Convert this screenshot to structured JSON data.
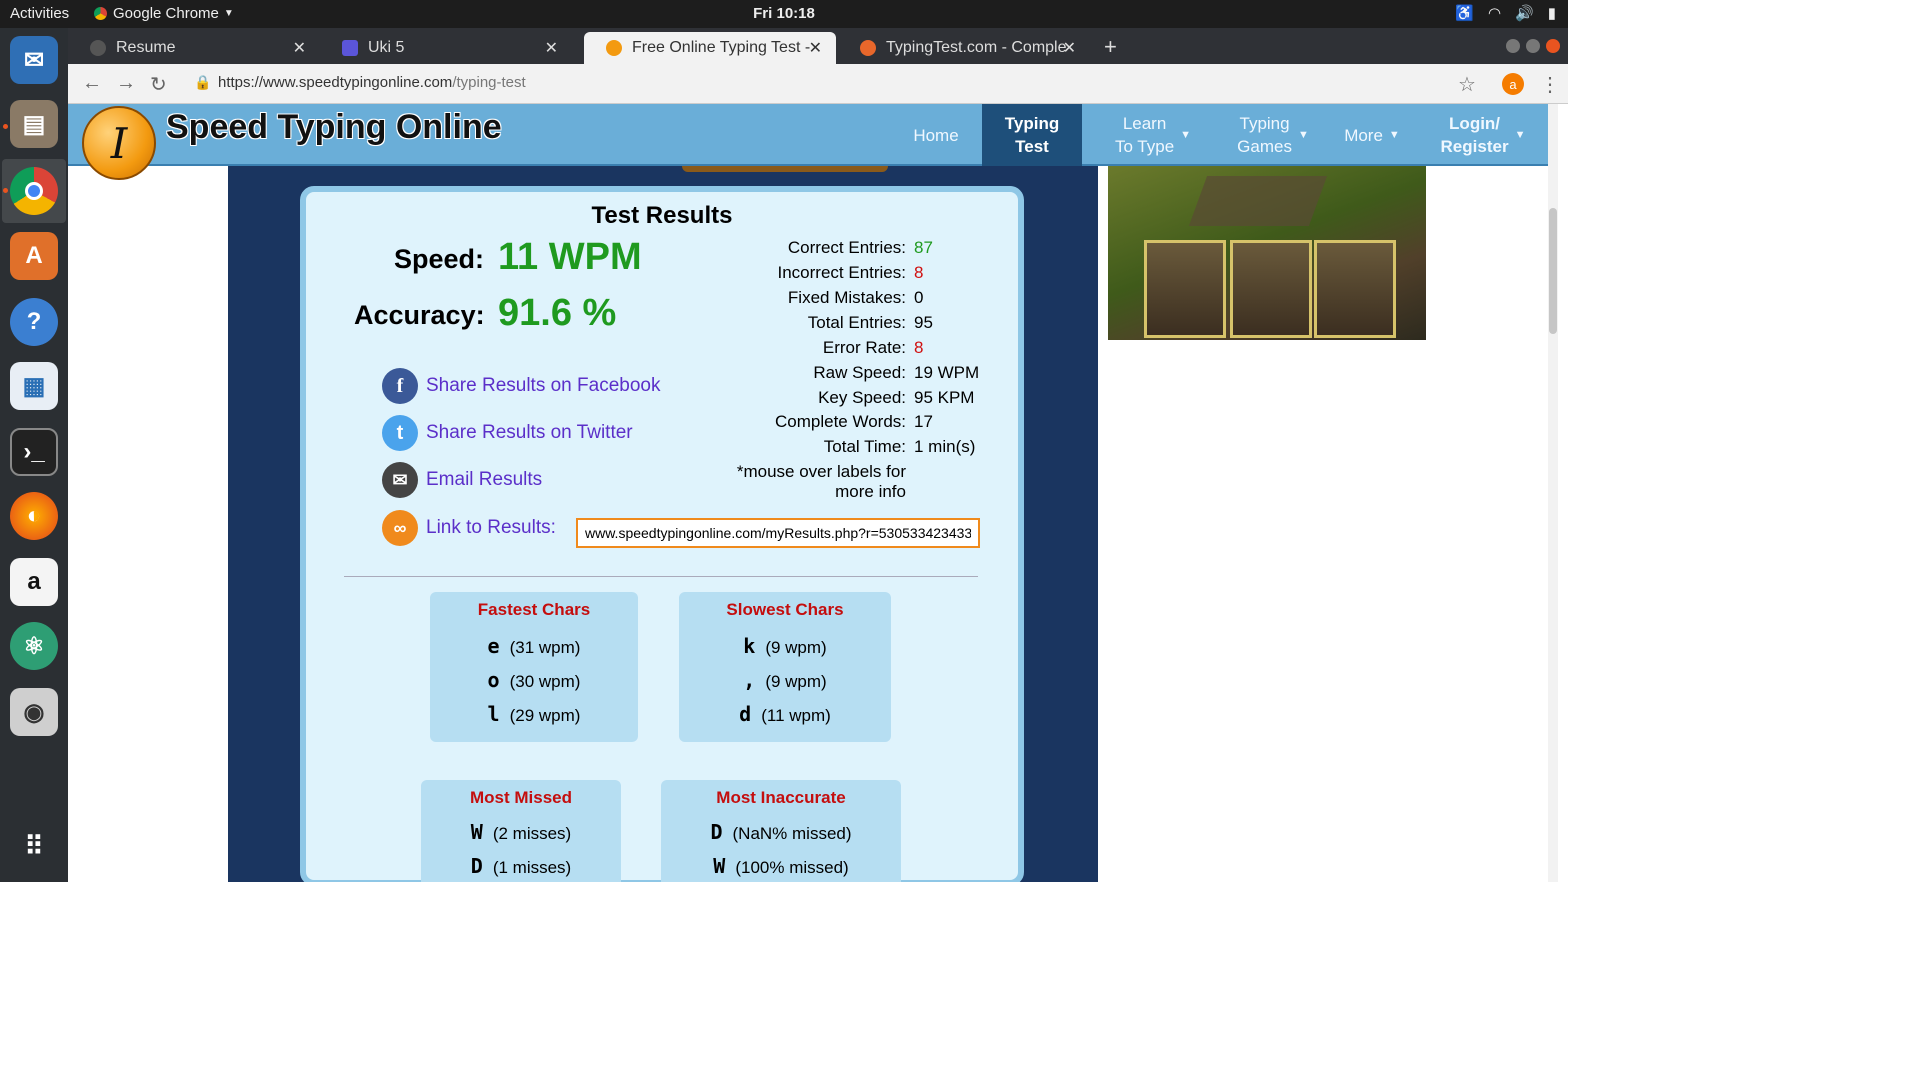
{
  "system": {
    "activities": "Activities",
    "app_name": "Google Chrome",
    "clock": "Fri 10:18"
  },
  "tabs": [
    {
      "title": "Resume",
      "favicon_color": "#555555"
    },
    {
      "title": "Uki 5",
      "favicon_color": "#5b55d9"
    },
    {
      "title": "Free Online Typing Test - S",
      "favicon_color": "#f39a10"
    },
    {
      "title": "TypingTest.com - Complete",
      "favicon_color": "#e8672b"
    }
  ],
  "url": {
    "scheme": "https://",
    "host": "www.speedtypingonline.com",
    "path": "/typing-test"
  },
  "profile_initial": "a",
  "site": {
    "brand": "Speed Typing Online",
    "logo_letter": "I",
    "nav": [
      {
        "label": "Home"
      },
      {
        "label": "Typing\nTest"
      },
      {
        "label": "Learn\nTo Type"
      },
      {
        "label": "Typing\nGames"
      },
      {
        "label": "More"
      },
      {
        "label": "Login/\nRegister"
      }
    ]
  },
  "results": {
    "title": "Test Results",
    "speed_label": "Speed:",
    "speed_value": "11 WPM",
    "accuracy_label": "Accuracy:",
    "accuracy_value": "91.6 %",
    "stats": [
      {
        "label": "Correct Entries:",
        "value": "87",
        "color": "#1f9a1f"
      },
      {
        "label": "Incorrect Entries:",
        "value": "8",
        "color": "#d01010"
      },
      {
        "label": "Fixed Mistakes:",
        "value": "0",
        "color": "#000000"
      },
      {
        "label": "Total Entries:",
        "value": "95",
        "color": "#000000"
      },
      {
        "label": "Error Rate:",
        "value": "8",
        "color": "#d01010"
      },
      {
        "label": "Raw Speed:",
        "value": "19 WPM",
        "color": "#000000"
      },
      {
        "label": "Key Speed:",
        "value": "95 KPM",
        "color": "#000000"
      },
      {
        "label": "Complete Words:",
        "value": "17",
        "color": "#000000"
      },
      {
        "label": "Total Time:",
        "value": "1 min(s)",
        "color": "#000000"
      }
    ],
    "mouse_note_1": "*mouse over labels for",
    "mouse_note_2": "more info",
    "share_facebook": "Share Results on Facebook",
    "share_twitter": "Share Results on Twitter",
    "email_results": "Email Results",
    "link_label": "Link to Results:",
    "link_value": "www.speedtypingonline.com/myResults.php?r=530533423433"
  },
  "char_boxes": {
    "fastest": {
      "title": "Fastest Chars",
      "rows": [
        {
          "char": "e",
          "info": "(31 wpm)"
        },
        {
          "char": "o",
          "info": "(30 wpm)"
        },
        {
          "char": "l",
          "info": "(29 wpm)"
        }
      ]
    },
    "slowest": {
      "title": "Slowest Chars",
      "rows": [
        {
          "char": "k",
          "info": "(9 wpm)"
        },
        {
          "char": ",",
          "info": "(9 wpm)"
        },
        {
          "char": "d",
          "info": "(11 wpm)"
        }
      ]
    },
    "missed": {
      "title": "Most Missed",
      "rows": [
        {
          "char": "W",
          "info": "(2 misses)"
        },
        {
          "char": "D",
          "info": "(1 misses)"
        }
      ]
    },
    "inaccurate": {
      "title": "Most Inaccurate",
      "rows": [
        {
          "char": "D",
          "info": "(NaN% missed)"
        },
        {
          "char": "W",
          "info": "(100% missed)"
        }
      ]
    }
  },
  "colors": {
    "accent_green": "#1f9a1f",
    "accent_red": "#d01010",
    "link_purple": "#5b2fc9",
    "nav_blue": "#6aaed8",
    "nav_active": "#1e4f7a"
  }
}
